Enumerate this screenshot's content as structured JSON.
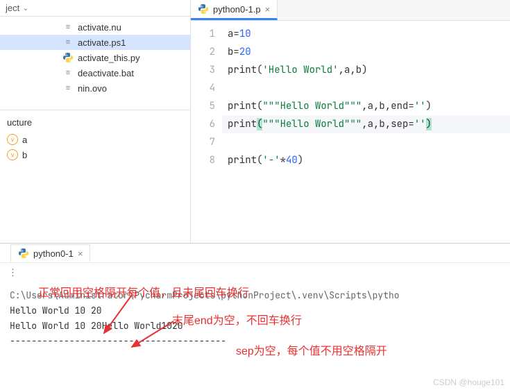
{
  "project": {
    "label": "ject"
  },
  "files": [
    {
      "name": "activate.nu",
      "iconType": "txt"
    },
    {
      "name": "activate.ps1",
      "iconType": "txt",
      "selected": true
    },
    {
      "name": "activate_this.py",
      "iconType": "py"
    },
    {
      "name": "deactivate.bat",
      "iconType": "txt"
    },
    {
      "name": "nin.ovo",
      "iconType": "txt"
    }
  ],
  "structure": {
    "title": "ucture",
    "items": [
      "a",
      "b"
    ]
  },
  "tab": {
    "label": "python0-1.p"
  },
  "code": {
    "lines": [
      {
        "n": 1,
        "tokens": [
          [
            "",
            "a="
          ],
          [
            "num",
            "10"
          ]
        ]
      },
      {
        "n": 2,
        "tokens": [
          [
            "",
            "b="
          ],
          [
            "num",
            "20"
          ]
        ]
      },
      {
        "n": 3,
        "tokens": [
          [
            "fn",
            "print"
          ],
          [
            "",
            "("
          ],
          [
            "str",
            "'Hello World'"
          ],
          [
            "",
            ",a,b)"
          ]
        ]
      },
      {
        "n": 4,
        "tokens": []
      },
      {
        "n": 5,
        "tokens": [
          [
            "fn",
            "print"
          ],
          [
            "",
            "("
          ],
          [
            "str",
            "\"\"\"Hello World\"\"\""
          ],
          [
            "",
            ",a,b,end="
          ],
          [
            "str",
            "''"
          ],
          [
            "",
            ")"
          ]
        ]
      },
      {
        "n": 6,
        "hl": true,
        "tokens": [
          [
            "fn",
            "print"
          ],
          [
            "match",
            "("
          ],
          [
            "str",
            "\"\"\"Hello World\"\"\""
          ],
          [
            "",
            ",a,b,sep="
          ],
          [
            "str",
            "''"
          ],
          [
            "match",
            ")"
          ]
        ]
      },
      {
        "n": 7,
        "tokens": []
      },
      {
        "n": 8,
        "tokens": [
          [
            "fn",
            "print"
          ],
          [
            "",
            "("
          ],
          [
            "str",
            "'-'"
          ],
          [
            "",
            "*"
          ],
          [
            "num",
            "40"
          ],
          [
            "",
            ")"
          ]
        ]
      }
    ]
  },
  "runTab": {
    "label": "python0-1"
  },
  "terminal": {
    "path": "C:\\Users\\Administrator\\PycharmProjects\\pythonProject\\.venv\\Scripts\\pytho",
    "line1": "Hello World 10 20",
    "line2a": "Hello World 10 20",
    "line2b": "Hello World1020",
    "dashes": "----------------------------------------"
  },
  "annotations": {
    "a1": "正常回用空格隔开每个值，且未尾回车换行",
    "a2": "末尾end为空，不回车换行",
    "a3": "sep为空，每个值不用空格隔开"
  },
  "watermark": "CSDN @houge101"
}
